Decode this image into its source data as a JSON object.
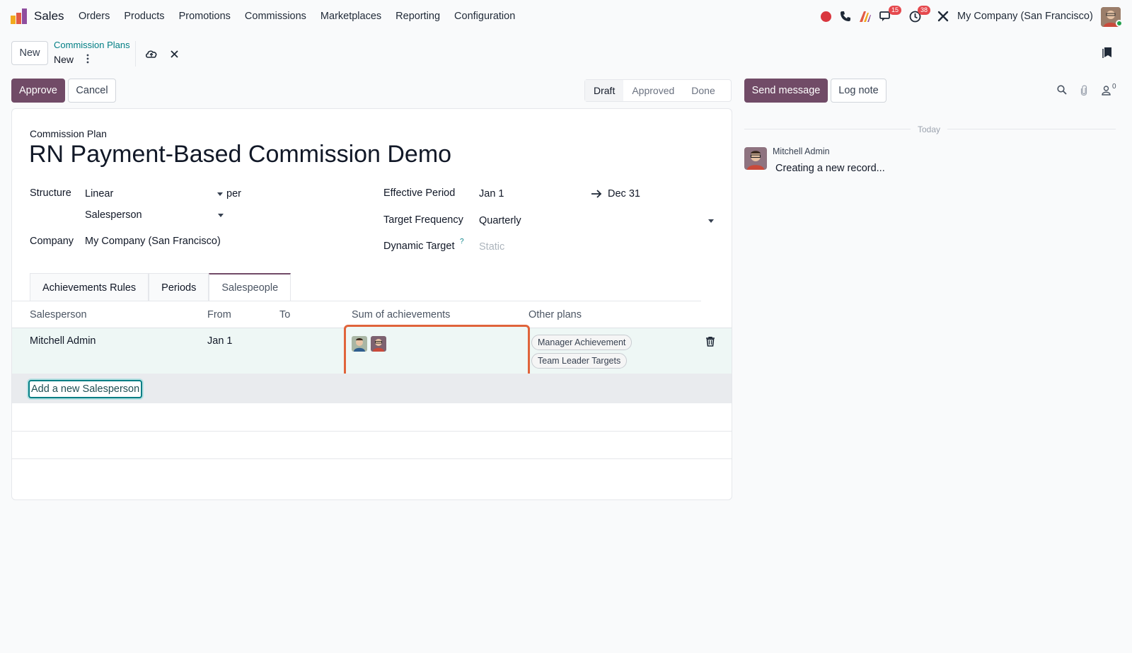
{
  "navbar": {
    "app_name": "Sales",
    "menu": [
      "Orders",
      "Products",
      "Promotions",
      "Commissions",
      "Marketplaces",
      "Reporting",
      "Configuration"
    ],
    "messages_badge": "15",
    "activities_badge": "38",
    "company": "My Company (San Francisco)",
    "icons": [
      "record-icon",
      "phone-icon",
      "ai-icon",
      "chat-icon",
      "clock-icon",
      "tools-icon"
    ]
  },
  "control": {
    "new_label": "New",
    "breadcrumb_parent": "Commission Plans",
    "breadcrumb_current": "New",
    "approve_label": "Approve",
    "cancel_label": "Cancel",
    "statuses": [
      "Draft",
      "Approved",
      "Done"
    ],
    "active_status": "Draft"
  },
  "form": {
    "sheet_label": "Commission Plan",
    "title": "RN Payment-Based Commission Demo",
    "structure_label": "Structure",
    "structure_value": "Linear",
    "per_label": "per",
    "per_value": "Salesperson",
    "company_label": "Company",
    "company_value": "My Company (San Francisco)",
    "effective_label": "Effective Period",
    "effective_from": "Jan 1",
    "effective_to": "Dec 31",
    "frequency_label": "Target Frequency",
    "frequency_value": "Quarterly",
    "dynamic_label": "Dynamic Target",
    "dynamic_help": "?",
    "dynamic_value": "Static"
  },
  "tabs": [
    "Achievements Rules",
    "Periods",
    "Salespeople"
  ],
  "active_tab": "Salespeople",
  "table": {
    "columns": [
      "Salesperson",
      "From",
      "To",
      "Sum of achievements",
      "Other plans"
    ],
    "rows": [
      {
        "salesperson": "Mitchell Admin",
        "from": "Jan 1",
        "to": "",
        "other_plans": [
          "Manager Achievement",
          "Team Leader Targets"
        ]
      }
    ],
    "add_label": "Add a new Salesperson"
  },
  "chatter": {
    "send_message_label": "Send message",
    "log_note_label": "Log note",
    "followers_count": "0",
    "date_separator": "Today",
    "messages": [
      {
        "author": "Mitchell Admin",
        "body": "Creating a new record..."
      }
    ]
  },
  "colors": {
    "primary": "#714b67",
    "link": "#017e84",
    "highlight": "#e0643b",
    "badge": "#e5484d"
  }
}
